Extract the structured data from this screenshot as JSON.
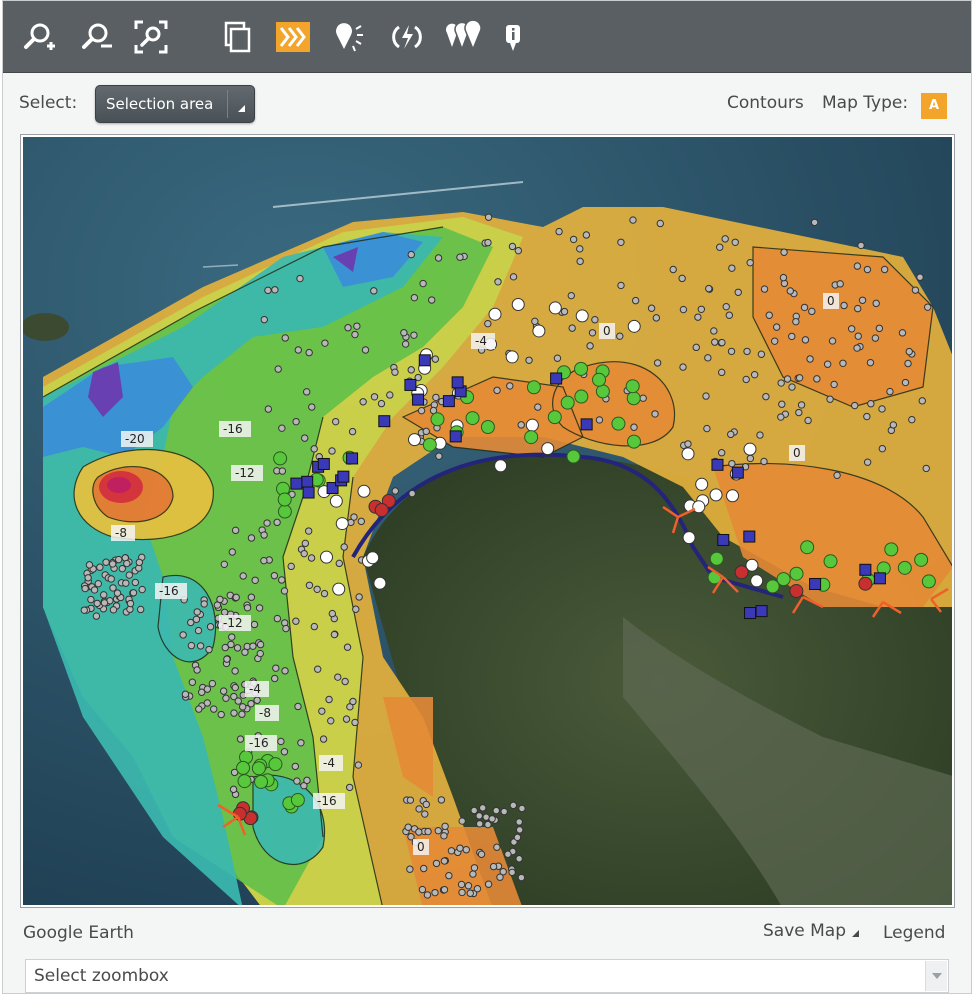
{
  "toolbar": {
    "buttons": [
      {
        "icon": "zoom-in-icon",
        "active": false
      },
      {
        "icon": "zoom-out-icon",
        "active": false
      },
      {
        "icon": "zoom-extent-icon",
        "active": false
      },
      {
        "icon": "layers-copy-icon",
        "active": false
      },
      {
        "icon": "chevrons-icon",
        "active": true
      },
      {
        "icon": "pin-sparkle-icon",
        "active": false
      },
      {
        "icon": "lightning-icon",
        "active": false
      },
      {
        "icon": "multi-pin-icon",
        "active": false
      },
      {
        "icon": "info-pin-icon",
        "active": false
      }
    ],
    "accent": "#f2a52a",
    "background": "#5a5f63"
  },
  "controls": {
    "select_label": "Select:",
    "select_value": "Selection area",
    "contours_label": "Contours",
    "map_type_label": "Map Type:",
    "map_type_value": "A"
  },
  "map": {
    "contour_labels": [
      "-20",
      "-16",
      "-12",
      "-8",
      "-16",
      "-12",
      "-4",
      "-16",
      "-4",
      "-8",
      "-16",
      "0",
      "0",
      "0",
      "-4",
      "0"
    ]
  },
  "footer": {
    "source_label": "Google Earth",
    "save_map_label": "Save Map",
    "legend_label": "Legend",
    "zoombox_value": "Select zoombox"
  }
}
